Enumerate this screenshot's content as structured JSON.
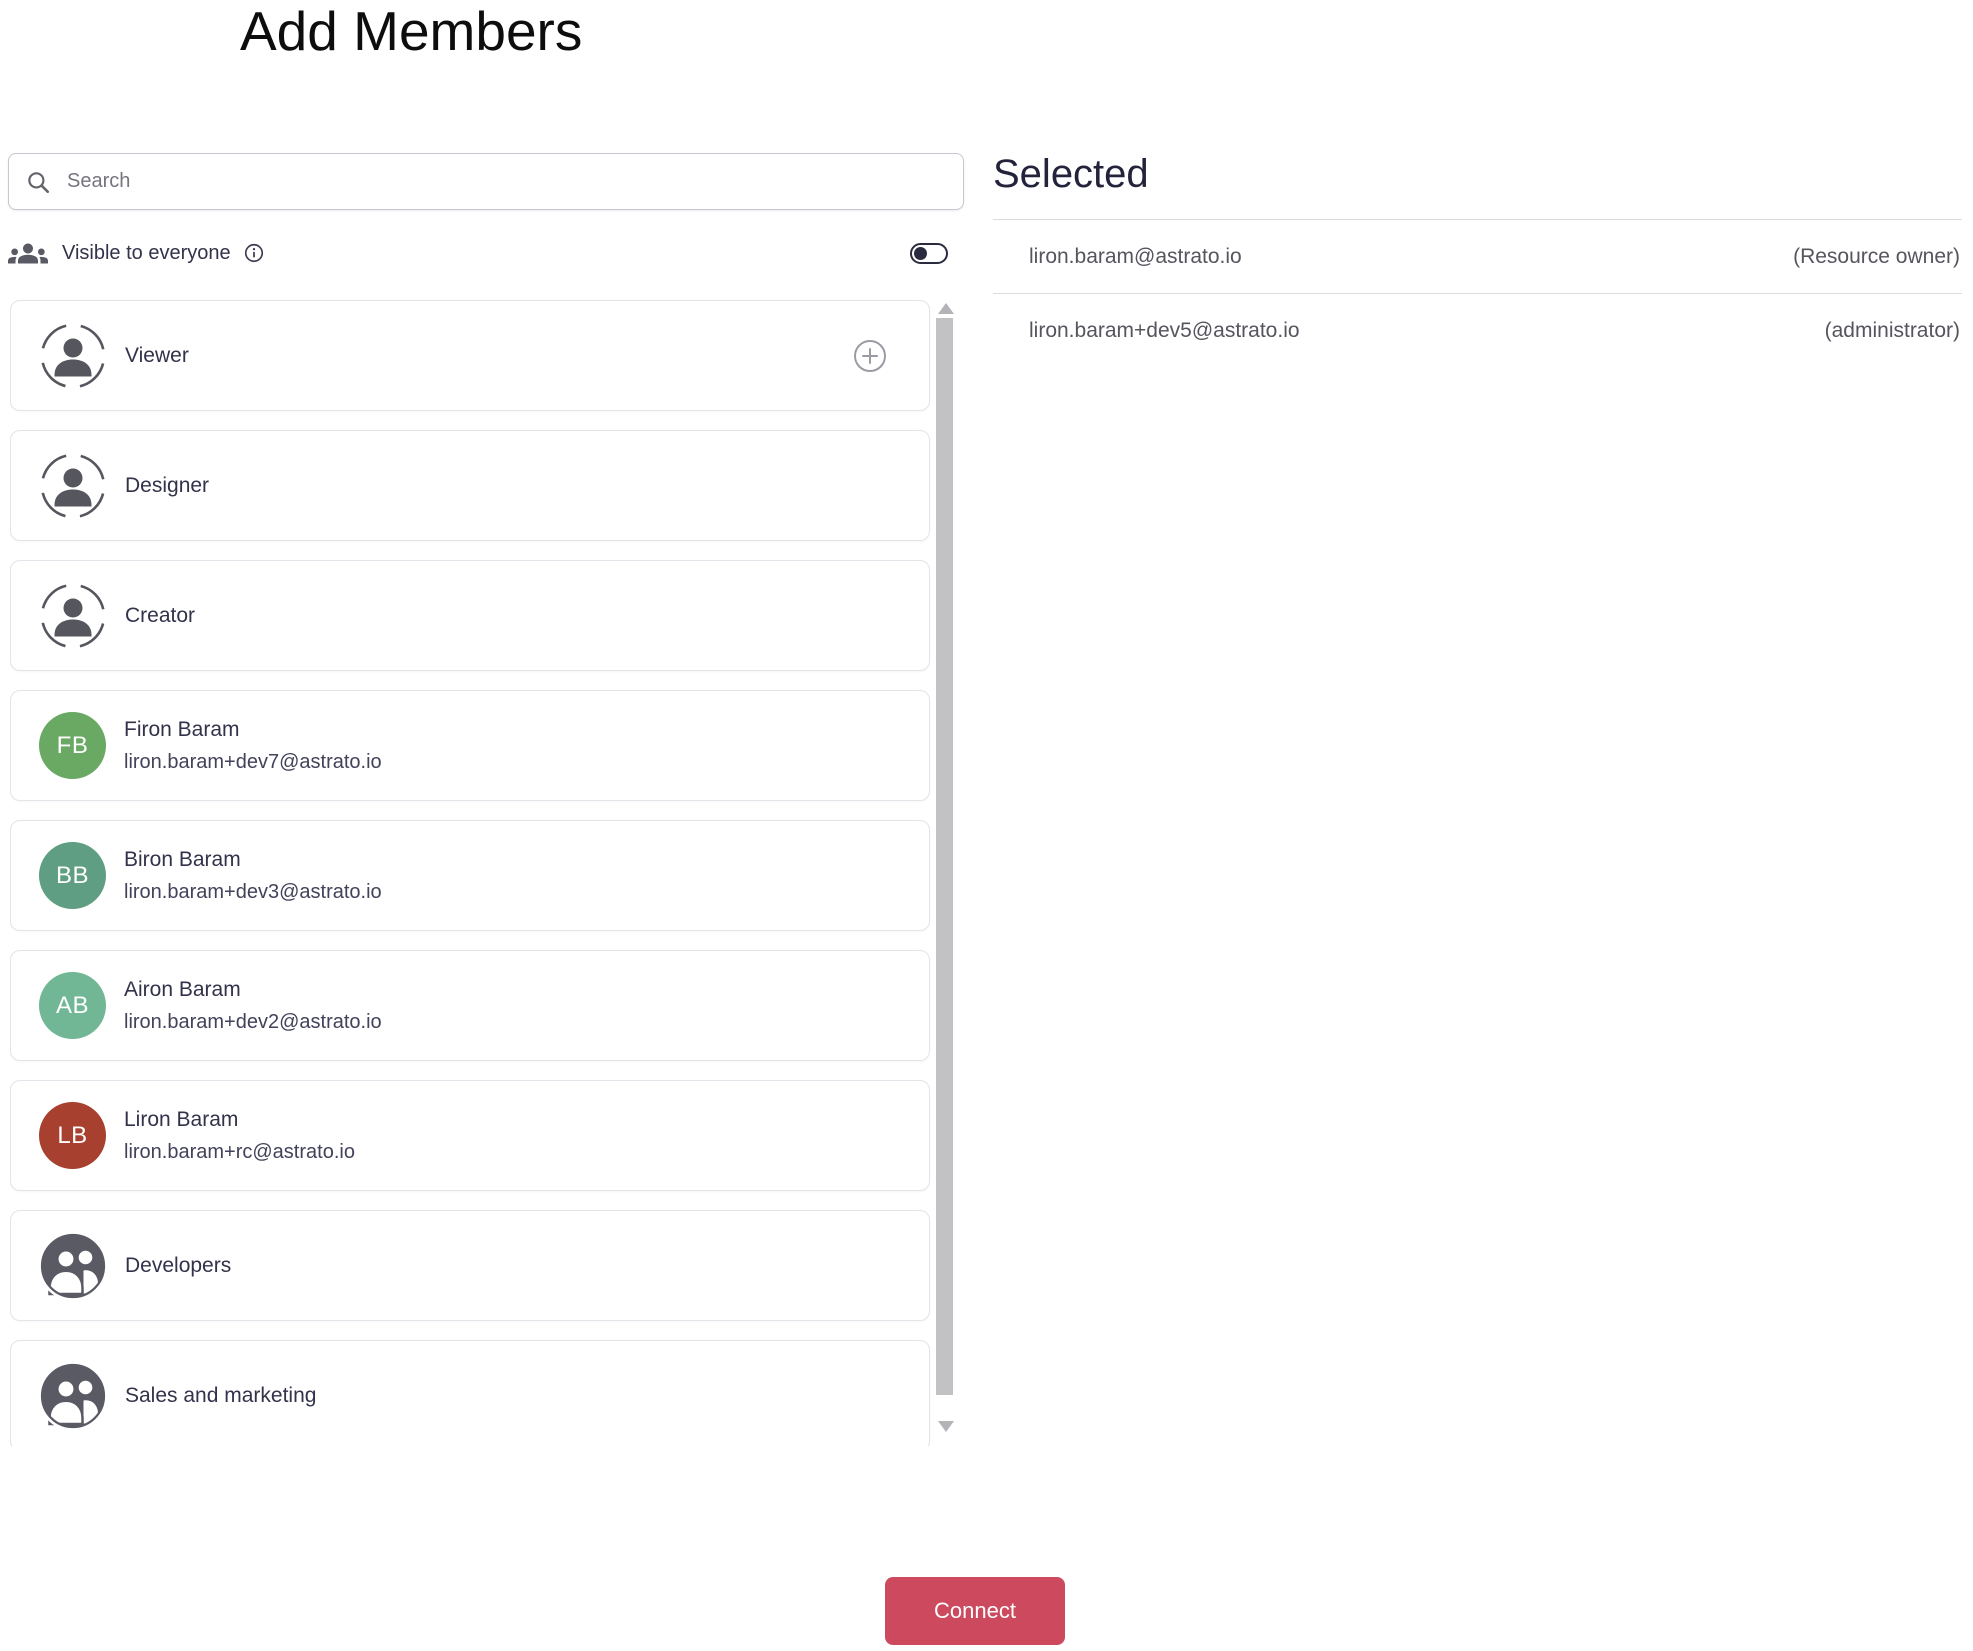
{
  "page": {
    "title": "Add Members"
  },
  "search": {
    "placeholder": "Search",
    "value": ""
  },
  "visibility": {
    "label": "Visible to everyone",
    "toggle_on": false
  },
  "list": {
    "items": [
      {
        "type": "role",
        "label": "Viewer",
        "has_add_button": true
      },
      {
        "type": "role",
        "label": "Designer"
      },
      {
        "type": "role",
        "label": "Creator"
      },
      {
        "type": "user",
        "name": "Firon Baram",
        "email": "liron.baram+dev7@astrato.io",
        "initials": "FB",
        "avatar_color": "#69a963"
      },
      {
        "type": "user",
        "name": "Biron Baram",
        "email": "liron.baram+dev3@astrato.io",
        "initials": "BB",
        "avatar_color": "#5f9e82"
      },
      {
        "type": "user",
        "name": "Airon Baram",
        "email": "liron.baram+dev2@astrato.io",
        "initials": "AB",
        "avatar_color": "#72b795"
      },
      {
        "type": "user",
        "name": "Liron Baram",
        "email": "liron.baram+rc@astrato.io",
        "initials": "LB",
        "avatar_color": "#a7402e"
      },
      {
        "type": "group",
        "label": "Developers"
      },
      {
        "type": "group",
        "label": "Sales and marketing"
      }
    ]
  },
  "selected": {
    "heading": "Selected",
    "members": [
      {
        "email": "liron.baram@astrato.io",
        "role": "(Resource owner)"
      },
      {
        "email": "liron.baram+dev5@astrato.io",
        "role": "(administrator)"
      }
    ]
  },
  "footer": {
    "connect_label": "Connect"
  },
  "colors": {
    "connect_button": "#cc495e",
    "toggle": "#2b2b40",
    "scrollbar_thumb": "#c2c2c5"
  }
}
